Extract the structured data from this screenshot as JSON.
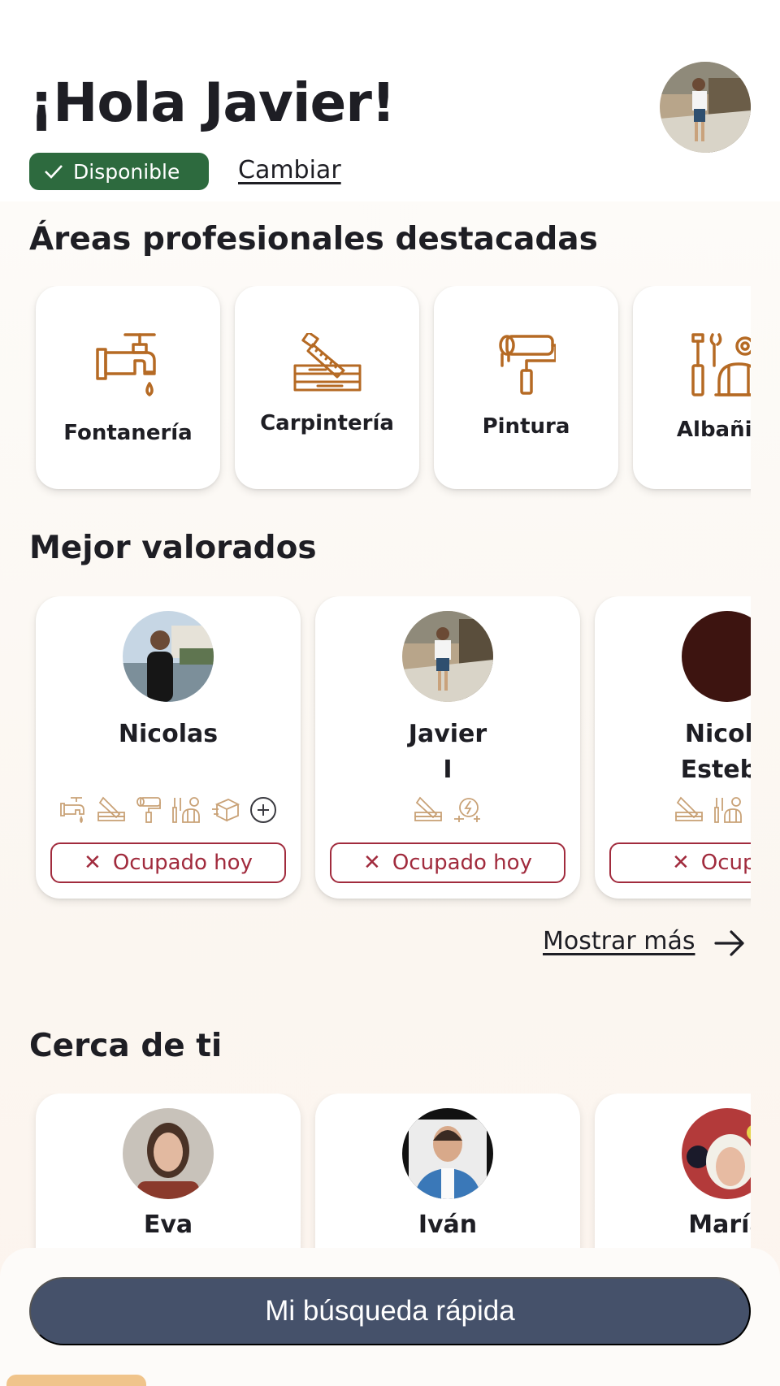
{
  "header": {
    "greeting": "¡Hola Javier!",
    "status_label": "Disponible",
    "change_link": "Cambiar"
  },
  "areas": {
    "title": "Áreas profesionales destacadas",
    "items": [
      {
        "label": "Fontanería",
        "icon": "faucet-icon"
      },
      {
        "label": "Carpintería",
        "icon": "saw-wood-icon"
      },
      {
        "label": "Pintura",
        "icon": "paint-roller-icon"
      },
      {
        "label": "Albañile",
        "icon": "tools-helmet-icon"
      }
    ]
  },
  "top_rated": {
    "title": "Mejor valorados",
    "more_link": "Mostrar más",
    "items": [
      {
        "name": "Nicolas",
        "status": "Ocupado hoy",
        "icons": [
          "faucet-icon",
          "saw-wood-icon",
          "paint-roller-icon",
          "tools-helmet-icon",
          "box-icon",
          "plus-circle-icon"
        ]
      },
      {
        "name": "Javier\nI",
        "status": "Ocupado hoy",
        "icons": [
          "saw-wood-icon",
          "electric-icon"
        ]
      },
      {
        "name": "Nicola\nEsteba",
        "status": "Ocupad",
        "icons": [
          "saw-wood-icon",
          "tools-helmet-icon",
          "worker-icon"
        ]
      }
    ]
  },
  "nearby": {
    "title": "Cerca de ti",
    "items": [
      {
        "name": "Eva"
      },
      {
        "name": "Iván"
      },
      {
        "name": "María"
      }
    ]
  },
  "quick_search_button": "Mi búsqueda rápida",
  "colors": {
    "available_green": "#2d6a3e",
    "busy_red": "#a12b3d",
    "icon_brown": "#b56a24",
    "primary_button": "#45516a"
  }
}
